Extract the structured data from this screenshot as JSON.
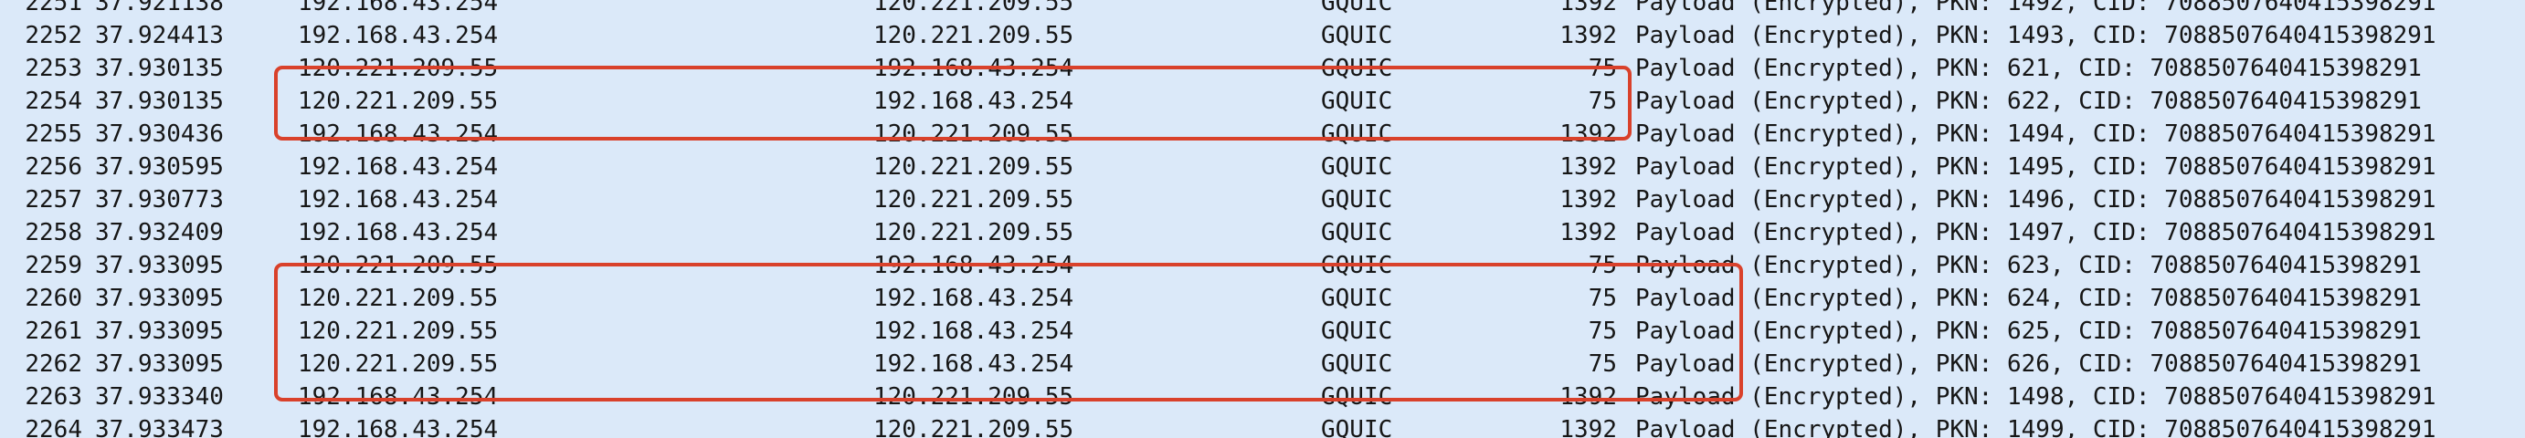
{
  "packets": [
    {
      "no": "2251",
      "time": "37.921138",
      "src": "192.168.43.254",
      "dst": "120.221.209.55",
      "proto": "GQUIC",
      "len": "1392",
      "info": "Payload (Encrypted), PKN: 1492, CID: 7088507640415398291"
    },
    {
      "no": "2252",
      "time": "37.924413",
      "src": "192.168.43.254",
      "dst": "120.221.209.55",
      "proto": "GQUIC",
      "len": "1392",
      "info": "Payload (Encrypted), PKN: 1493, CID: 7088507640415398291"
    },
    {
      "no": "2253",
      "time": "37.930135",
      "src": "120.221.209.55",
      "dst": "192.168.43.254",
      "proto": "GQUIC",
      "len": "75",
      "info": "Payload (Encrypted), PKN: 621, CID: 7088507640415398291"
    },
    {
      "no": "2254",
      "time": "37.930135",
      "src": "120.221.209.55",
      "dst": "192.168.43.254",
      "proto": "GQUIC",
      "len": "75",
      "info": "Payload (Encrypted), PKN: 622, CID: 7088507640415398291"
    },
    {
      "no": "2255",
      "time": "37.930436",
      "src": "192.168.43.254",
      "dst": "120.221.209.55",
      "proto": "GQUIC",
      "len": "1392",
      "info": "Payload (Encrypted), PKN: 1494, CID: 7088507640415398291"
    },
    {
      "no": "2256",
      "time": "37.930595",
      "src": "192.168.43.254",
      "dst": "120.221.209.55",
      "proto": "GQUIC",
      "len": "1392",
      "info": "Payload (Encrypted), PKN: 1495, CID: 7088507640415398291"
    },
    {
      "no": "2257",
      "time": "37.930773",
      "src": "192.168.43.254",
      "dst": "120.221.209.55",
      "proto": "GQUIC",
      "len": "1392",
      "info": "Payload (Encrypted), PKN: 1496, CID: 7088507640415398291"
    },
    {
      "no": "2258",
      "time": "37.932409",
      "src": "192.168.43.254",
      "dst": "120.221.209.55",
      "proto": "GQUIC",
      "len": "1392",
      "info": "Payload (Encrypted), PKN: 1497, CID: 7088507640415398291"
    },
    {
      "no": "2259",
      "time": "37.933095",
      "src": "120.221.209.55",
      "dst": "192.168.43.254",
      "proto": "GQUIC",
      "len": "75",
      "info": "Payload (Encrypted), PKN: 623, CID: 7088507640415398291"
    },
    {
      "no": "2260",
      "time": "37.933095",
      "src": "120.221.209.55",
      "dst": "192.168.43.254",
      "proto": "GQUIC",
      "len": "75",
      "info": "Payload (Encrypted), PKN: 624, CID: 7088507640415398291"
    },
    {
      "no": "2261",
      "time": "37.933095",
      "src": "120.221.209.55",
      "dst": "192.168.43.254",
      "proto": "GQUIC",
      "len": "75",
      "info": "Payload (Encrypted), PKN: 625, CID: 7088507640415398291"
    },
    {
      "no": "2262",
      "time": "37.933095",
      "src": "120.221.209.55",
      "dst": "192.168.43.254",
      "proto": "GQUIC",
      "len": "75",
      "info": "Payload (Encrypted), PKN: 626, CID: 7088507640415398291"
    },
    {
      "no": "2263",
      "time": "37.933340",
      "src": "192.168.43.254",
      "dst": "120.221.209.55",
      "proto": "GQUIC",
      "len": "1392",
      "info": "Payload (Encrypted), PKN: 1498, CID: 7088507640415398291"
    },
    {
      "no": "2264",
      "time": "37.933473",
      "src": "192.168.43.254",
      "dst": "120.221.209.55",
      "proto": "GQUIC",
      "len": "1392",
      "info": "Payload (Encrypted), PKN: 1499, CID: 7088507640415398291"
    }
  ],
  "colors": {
    "row_background": "#dbe9f9",
    "text": "#161616",
    "annotation_box": "#d9412b"
  }
}
